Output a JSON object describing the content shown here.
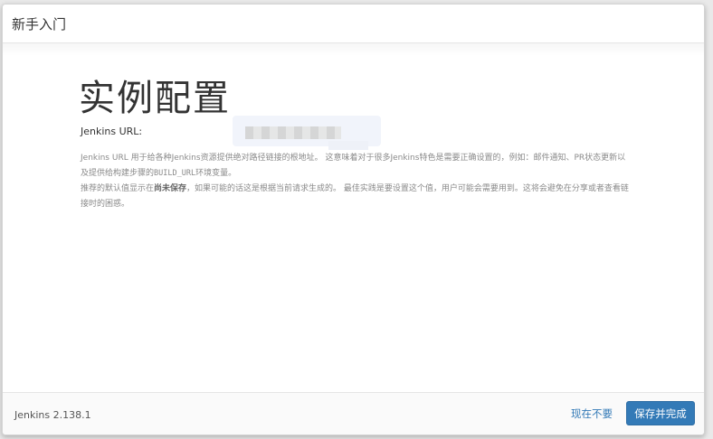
{
  "header": {
    "title": "新手入门"
  },
  "main": {
    "title": "实例配置",
    "url_label": "Jenkins URL:",
    "help": {
      "p1_a": "Jenkins URL 用于给各种Jenkins资源提供绝对路径链接的根地址。 这意味着对于很多Jenkins特色是需要正确设置的，例如：邮件通知、PR状态更新以及提供给构建步骤的",
      "p1_code": "BUILD_URL",
      "p1_b": "环境变量。",
      "p2_a": "推荐的默认值显示在",
      "p2_bold": "尚未保存",
      "p2_b": "，如果可能的话这是根据当前请求生成的。 最佳实践是要设置这个值，用户可能会需要用到。这将会避免在分享或者查看链接时的困惑。"
    }
  },
  "footer": {
    "version": "Jenkins 2.138.1",
    "skip_label": "现在不要",
    "save_label": "保存并完成"
  },
  "colors": {
    "primary": "#337ab7",
    "link": "#337ab7"
  }
}
